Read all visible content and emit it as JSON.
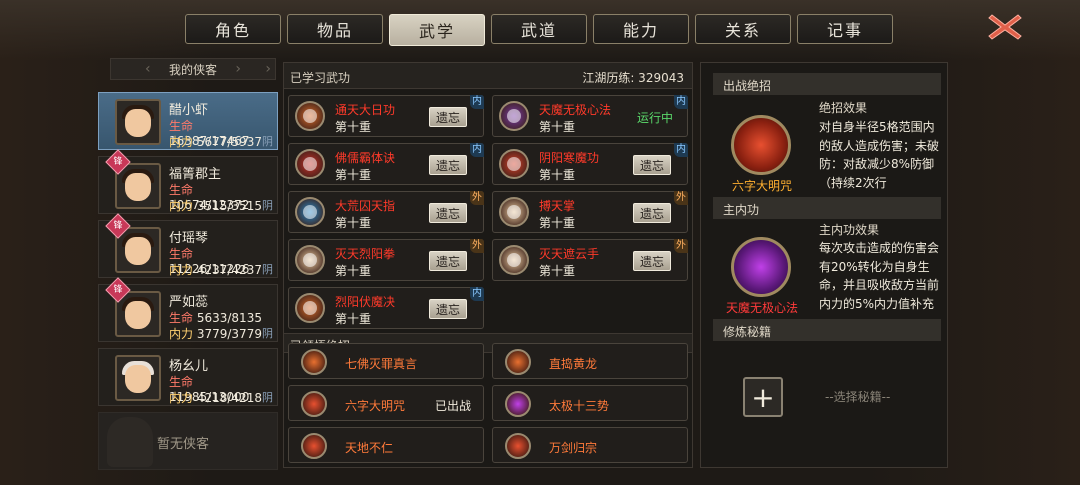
{
  "tabs": [
    {
      "label": "角色",
      "active": false
    },
    {
      "label": "物品",
      "active": false
    },
    {
      "label": "武学",
      "active": true
    },
    {
      "label": "武道",
      "active": false
    },
    {
      "label": "能力",
      "active": false
    },
    {
      "label": "关系",
      "active": false
    },
    {
      "label": "记事",
      "active": false
    }
  ],
  "left": {
    "title": "我的侠客",
    "heroes": [
      {
        "name": "醋小虾",
        "hp": "16387/17467",
        "mp": "5677/5937",
        "elem": "阴",
        "badge": "",
        "active": true
      },
      {
        "name": "福箐郡主",
        "hp": "10674/12372",
        "mp": "3515/3515",
        "elem": "阴",
        "badge": "锋",
        "active": false
      },
      {
        "name": "付瑶琴",
        "hp": "11226/11226",
        "mp": "4237/4237",
        "elem": "阴",
        "badge": "锋",
        "active": false
      },
      {
        "name": "严如蕊",
        "hp": "5633/8135",
        "mp": "3779/3779",
        "elem": "阴",
        "badge": "锋",
        "active": false
      },
      {
        "name": "杨幺儿",
        "hp": "11985/13000",
        "mp": "4218/4218",
        "elem": "阴",
        "badge": "",
        "active": false
      }
    ],
    "hp_label": "生命",
    "mp_label": "内力",
    "empty_label": "暂无侠客"
  },
  "center": {
    "learned_label": "已学习武功",
    "exp_label": "江湖历练: 329043",
    "skills": [
      {
        "name": "通天大日功",
        "level": "第十重",
        "action": "遗忘",
        "tag": "内",
        "tag_type": "inner",
        "color": "#d86a2a"
      },
      {
        "name": "天魔无极心法",
        "level": "第十重",
        "action": "运行中",
        "tag": "内",
        "tag_type": "inner",
        "color": "#7a3aa8"
      },
      {
        "name": "佛儒霸体诀",
        "level": "第十重",
        "action": "遗忘",
        "tag": "内",
        "tag_type": "inner",
        "color": "#c8302a"
      },
      {
        "name": "阴阳寒魔功",
        "level": "第十重",
        "action": "遗忘",
        "tag": "内",
        "tag_type": "inner",
        "color": "#d8402a"
      },
      {
        "name": "大荒囚天指",
        "level": "第十重",
        "action": "遗忘",
        "tag": "外",
        "tag_type": "outer",
        "color": "#2a88c8"
      },
      {
        "name": "搏天掌",
        "level": "第十重",
        "action": "遗忘",
        "tag": "外",
        "tag_type": "outer",
        "color": "#e8c8a0"
      },
      {
        "name": "灭天烈阳拳",
        "level": "第十重",
        "action": "遗忘",
        "tag": "外",
        "tag_type": "outer",
        "color": "#e8c8a0"
      },
      {
        "name": "灭天遮云手",
        "level": "第十重",
        "action": "遗忘",
        "tag": "外",
        "tag_type": "outer",
        "color": "#e8c8a0"
      },
      {
        "name": "烈阳伏魔决",
        "level": "第十重",
        "action": "遗忘",
        "tag": "内",
        "tag_type": "inner",
        "color": "#d86a2a"
      }
    ],
    "ult_label": "已领悟绝招",
    "ultimates": [
      {
        "name": "七佛灭罪真言",
        "status": ""
      },
      {
        "name": "直捣黄龙",
        "status": ""
      },
      {
        "name": "六字大明咒",
        "status": "已出战"
      },
      {
        "name": "太极十三势",
        "status": ""
      },
      {
        "name": "天地不仁",
        "status": ""
      },
      {
        "name": "万剑归宗",
        "status": ""
      }
    ]
  },
  "right": {
    "sec1": "出战绝招",
    "sec1_title": "绝招效果",
    "sec1_desc": "对自身半径5格范围内的敌人造成伤害；未破防：对敌减少8%防御（持续2次行",
    "sec1_name": "六字大明咒",
    "sec2": "主内功",
    "sec2_title": "主内功效果",
    "sec2_desc": "每次攻击造成的伤害会有20%转化为自身生命，并且吸收敌方当前内力的5%内力值补充为自己的内",
    "sec2_name": "天魔无极心法",
    "sec3": "修炼秘籍",
    "select": "--选择秘籍--",
    "add": "+"
  }
}
